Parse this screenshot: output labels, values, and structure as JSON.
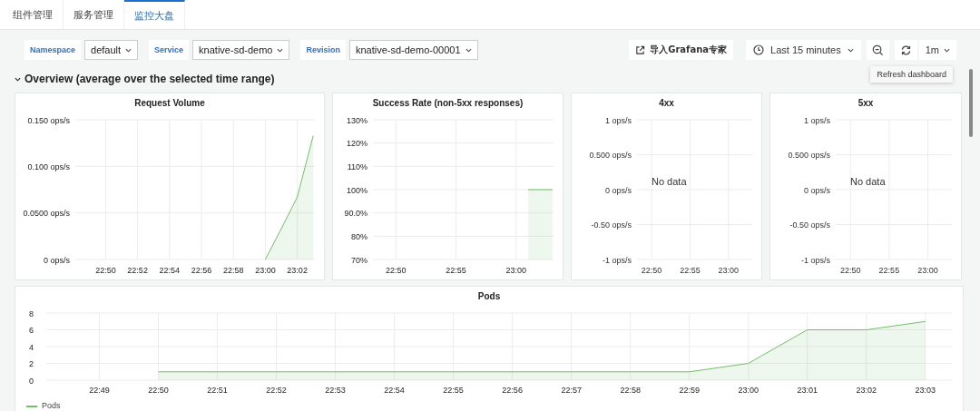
{
  "tabs": [
    {
      "label": "组件管理",
      "selected": false
    },
    {
      "label": "服务管理",
      "selected": false
    },
    {
      "label": "监控大盘",
      "selected": true
    }
  ],
  "variables": [
    {
      "label": "Namespace",
      "value": "default"
    },
    {
      "label": "Service",
      "value": "knative-sd-demo"
    },
    {
      "label": "Revision",
      "value": "knative-sd-demo-00001"
    }
  ],
  "toolbar": {
    "import_button": "导入Grafana专家",
    "time_range": "Last 15 minutes",
    "refresh_interval": "1m",
    "tooltip": "Refresh dashboard"
  },
  "row": {
    "title": "Overview (average over the selected time range)",
    "expanded": true
  },
  "panels": [
    {
      "title": "Request Volume",
      "chart_data": {
        "type": "area",
        "grid": true,
        "categories": [
          null,
          "22:50",
          null,
          "22:52",
          null,
          "22:54",
          null,
          "22:56",
          null,
          "22:58",
          null,
          "23:00",
          null,
          "23:02",
          null
        ],
        "ylim": [
          0,
          0.15
        ],
        "yticks": [
          {
            "value": 0,
            "label": "0 ops/s"
          },
          {
            "value": 0.05,
            "label": "0.0500 ops/s"
          },
          {
            "value": 0.1,
            "label": "0.100 ops/s"
          },
          {
            "value": 0.15,
            "label": "0.150 ops/s"
          }
        ],
        "series": [
          {
            "color": "#73bf69",
            "values": [
              null,
              null,
              null,
              null,
              null,
              null,
              null,
              null,
              null,
              null,
              null,
              0,
              0.033,
              0.067,
              0.133
            ]
          }
        ]
      }
    },
    {
      "title": "Success Rate (non-5xx responses)",
      "chart_data": {
        "type": "area",
        "grid": true,
        "categories": [
          null,
          "22:50",
          null,
          null,
          null,
          null,
          "22:55",
          null,
          null,
          null,
          null,
          "23:00",
          null,
          null,
          null
        ],
        "ylim": [
          70,
          130
        ],
        "yticks": [
          {
            "value": 70,
            "label": "70%"
          },
          {
            "value": 80,
            "label": "80%"
          },
          {
            "value": 90,
            "label": "90.0%"
          },
          {
            "value": 100,
            "label": "100%"
          },
          {
            "value": 110,
            "label": "110%"
          },
          {
            "value": 120,
            "label": "120%"
          },
          {
            "value": 130,
            "label": "130%"
          }
        ],
        "series": [
          {
            "color": "#73bf69",
            "values": [
              null,
              null,
              null,
              null,
              null,
              null,
              null,
              null,
              null,
              null,
              null,
              null,
              100,
              100,
              100
            ]
          }
        ]
      }
    },
    {
      "title": "4xx",
      "message": "No data",
      "chart_data": {
        "type": "line",
        "grid": true,
        "categories": [
          null,
          "22:50",
          null,
          null,
          null,
          null,
          "22:55",
          null,
          null,
          null,
          null,
          "23:00",
          null,
          null,
          null
        ],
        "ylim": [
          -1,
          1
        ],
        "yticks": [
          {
            "value": -1,
            "label": "-1 ops/s"
          },
          {
            "value": -0.5,
            "label": "-0.50 ops/s"
          },
          {
            "value": 0,
            "label": "0 ops/s"
          },
          {
            "value": 0.5,
            "label": "0.500 ops/s"
          },
          {
            "value": 1,
            "label": "1 ops/s"
          }
        ]
      }
    },
    {
      "title": "5xx",
      "message": "No data",
      "chart_data": {
        "type": "line",
        "grid": true,
        "categories": [
          null,
          "22:50",
          null,
          null,
          null,
          null,
          "22:55",
          null,
          null,
          null,
          null,
          "23:00",
          null,
          null,
          null
        ],
        "ylim": [
          -1,
          1
        ],
        "yticks": [
          {
            "value": -1,
            "label": "-1 ops/s"
          },
          {
            "value": -0.5,
            "label": "-0.50 ops/s"
          },
          {
            "value": 0,
            "label": "0 ops/s"
          },
          {
            "value": 0.5,
            "label": "0.500 ops/s"
          },
          {
            "value": 1,
            "label": "1 ops/s"
          }
        ]
      }
    }
  ],
  "pods_panel": {
    "title": "Pods",
    "chart_data": {
      "type": "area",
      "grid": true,
      "categories": [
        "22:49",
        "22:50",
        "22:51",
        "22:52",
        "22:53",
        "22:54",
        "22:55",
        "22:56",
        "22:57",
        "22:58",
        "22:59",
        "23:00",
        "23:01",
        "23:02",
        "23:03"
      ],
      "ylim": [
        0,
        8
      ],
      "yticks": [
        0,
        2,
        4,
        6,
        8
      ],
      "series": [
        {
          "name": "Pods",
          "color": "#73bf69",
          "values": [
            null,
            1,
            1,
            1,
            1,
            1,
            1,
            1,
            1,
            1,
            1,
            2,
            6,
            6,
            7
          ]
        }
      ]
    }
  }
}
